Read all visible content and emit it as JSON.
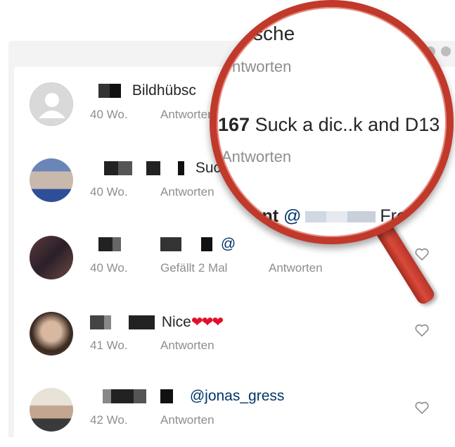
{
  "comments": [
    {
      "text": "Bildhübsc",
      "age": "40 Wo.",
      "reply": "Antworten",
      "likes": ""
    },
    {
      "text": "Suc",
      "age": "40 Wo.",
      "reply": "Antworten",
      "likes": ""
    },
    {
      "text": "@",
      "age": "40 Wo.",
      "reply": "Antworten",
      "likes": "Gefällt 2 Mal"
    },
    {
      "text": "Nice",
      "hearts": "❤❤❤",
      "age": "41 Wo.",
      "reply": "Antworten",
      "likes": ""
    },
    {
      "text": "@jonas_gress",
      "age": "42 Wo.",
      "reply": "Antworten",
      "likes": ""
    }
  ],
  "magnifier": {
    "line1": "sche",
    "line2": "twortwen",
    "line2_text": "ntworten",
    "count": "167",
    "comment": "Suck a dic..k and D13",
    "reply": "Antworten",
    "line5_user": "shunt",
    "line5_at": "@",
    "line5_tail": "Fre",
    "line6": "Mal      Antw"
  },
  "icons": {
    "heart": "heart-outline-icon",
    "avatar": "default-avatar-icon"
  },
  "colors": {
    "accent": "#c0392b",
    "mention": "#003569",
    "meta": "#8e8e8e",
    "heart": "#e0102c"
  }
}
